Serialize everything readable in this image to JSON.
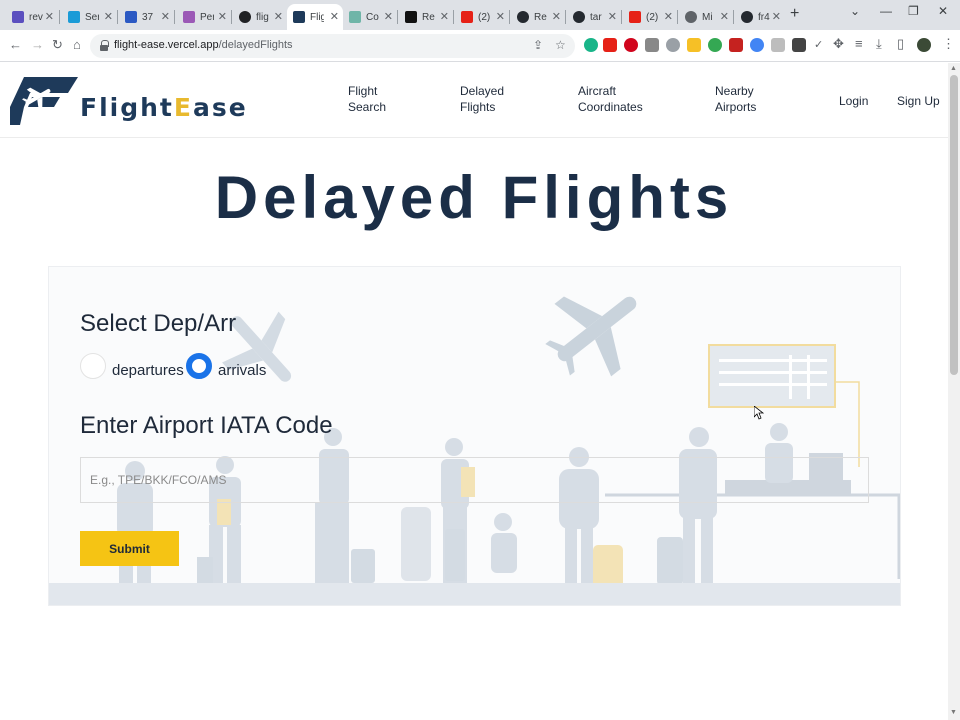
{
  "browser": {
    "tabs": [
      {
        "title": "rev",
        "color": "#5b4fbf"
      },
      {
        "title": "Ser",
        "color": "#1a9bd7"
      },
      {
        "title": "37",
        "color": "#2b59c3"
      },
      {
        "title": "Per",
        "color": "#9b59b6"
      },
      {
        "title": "flig",
        "color": "#202124"
      },
      {
        "title": "Flig",
        "color": "#1e3a5a"
      },
      {
        "title": "Co",
        "color": "#6fb5a8"
      },
      {
        "title": "Re",
        "color": "#111111"
      },
      {
        "title": "(2)",
        "color": "#e62117"
      },
      {
        "title": "Re",
        "color": "#24292f"
      },
      {
        "title": "tar",
        "color": "#24292f"
      },
      {
        "title": "(2)",
        "color": "#e62117"
      },
      {
        "title": "Mi",
        "color": "#5f6368"
      },
      {
        "title": "fr4",
        "color": "#24292f"
      }
    ],
    "url_host": "flight-ease.vercel.app",
    "url_path": "/delayedFlights"
  },
  "site": {
    "logo_first": "Flight",
    "logo_gold": "E",
    "logo_last": "ase",
    "nav": [
      {
        "line1": "Flight",
        "line2": "Search"
      },
      {
        "line1": "Delayed",
        "line2": "Flights"
      },
      {
        "line1": "Aircraft",
        "line2": "Coordinates"
      },
      {
        "line1": "Nearby",
        "line2": "Airports"
      }
    ],
    "login": "Login",
    "signup": "Sign Up"
  },
  "main": {
    "title": "Delayed Flights",
    "select_label": "Select Dep/Arr",
    "options": [
      "departures",
      "arrivals"
    ],
    "selected_option": "arrivals",
    "iata_label": "Enter Airport IATA Code",
    "iata_value": "",
    "iata_placeholder": "E.g., TPE/BKK/FCO/AMS",
    "submit_label": "Submit"
  },
  "colors": {
    "brand_navy": "#1e3a5a",
    "brand_gold": "#e8b92e",
    "submit_bg": "#f5c414",
    "radio_selected": "#1a73e8"
  }
}
